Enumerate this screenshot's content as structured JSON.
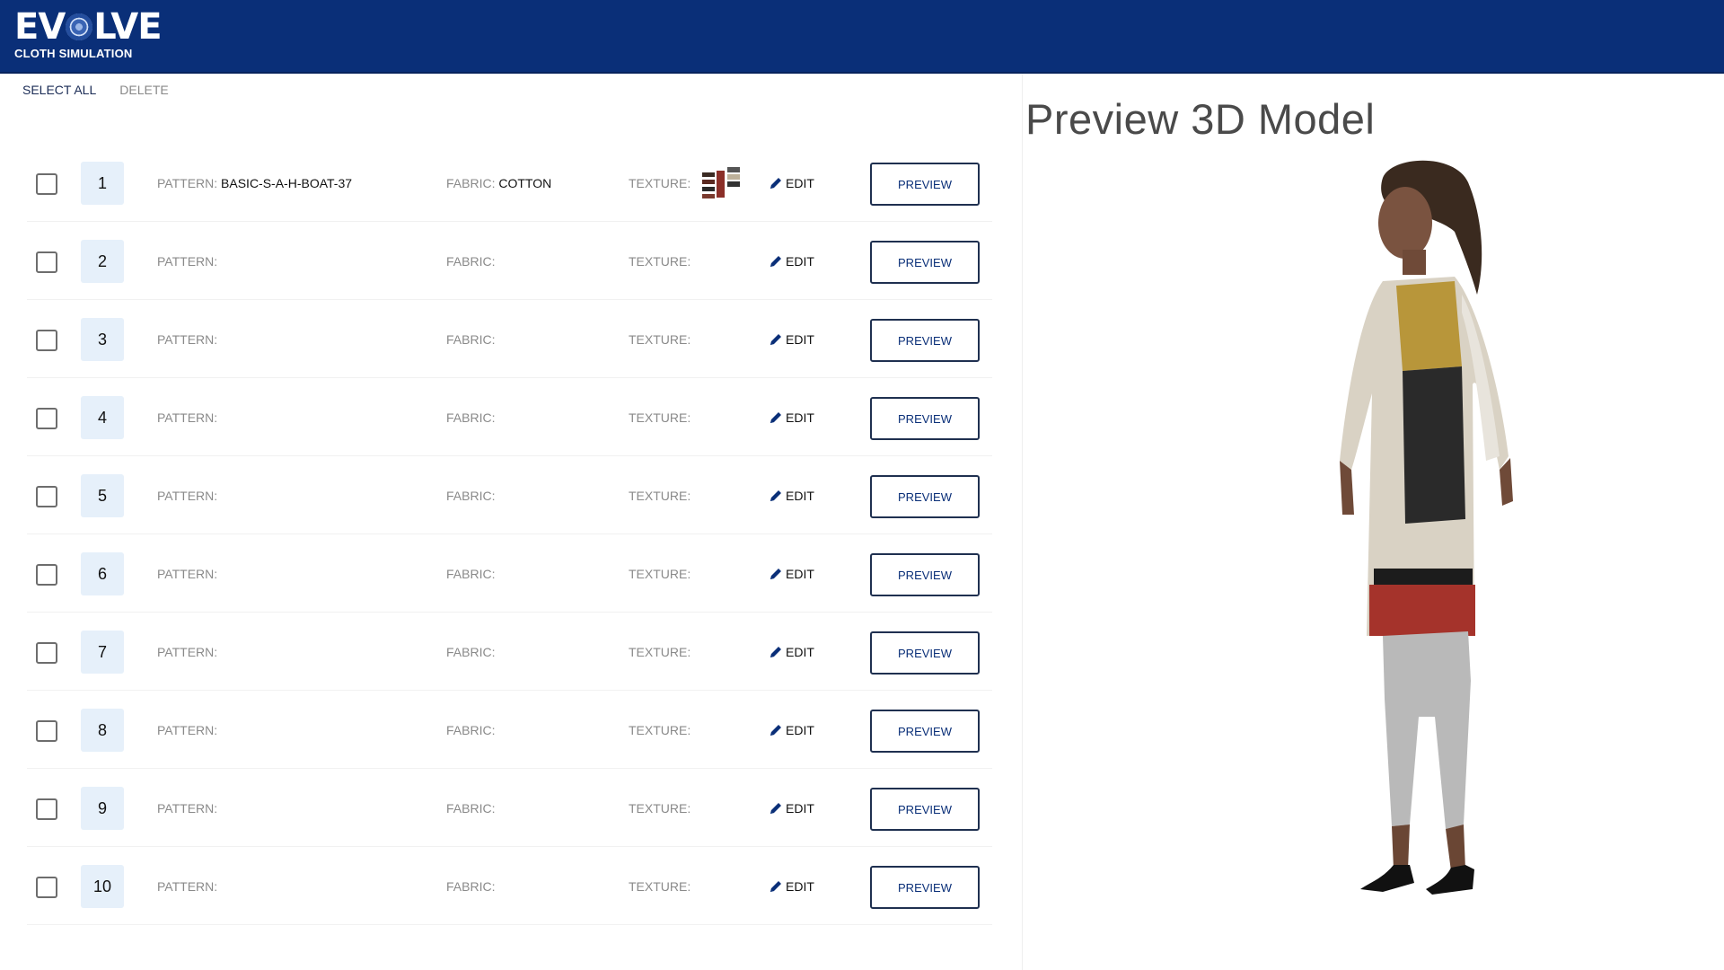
{
  "app": {
    "logo_main_left": "EV",
    "logo_main_right": "LVE",
    "logo_sub": "CLOTH SIMULATION"
  },
  "toolbar": {
    "select_all": "SELECT ALL",
    "delete": "DELETE"
  },
  "labels": {
    "pattern": "PATTERN:",
    "fabric": "FABRIC:",
    "texture": "TEXTURE:",
    "edit": "EDIT",
    "preview": "PREVIEW"
  },
  "rows": [
    {
      "number": "1",
      "pattern": "BASIC-S-A-H-BOAT-37",
      "fabric": "COTTON",
      "has_texture": true,
      "checked": false
    },
    {
      "number": "2",
      "pattern": "",
      "fabric": "",
      "has_texture": false,
      "checked": false
    },
    {
      "number": "3",
      "pattern": "",
      "fabric": "",
      "has_texture": false,
      "checked": false
    },
    {
      "number": "4",
      "pattern": "",
      "fabric": "",
      "has_texture": false,
      "checked": false
    },
    {
      "number": "5",
      "pattern": "",
      "fabric": "",
      "has_texture": false,
      "checked": false
    },
    {
      "number": "6",
      "pattern": "",
      "fabric": "",
      "has_texture": false,
      "checked": false
    },
    {
      "number": "7",
      "pattern": "",
      "fabric": "",
      "has_texture": false,
      "checked": false
    },
    {
      "number": "8",
      "pattern": "",
      "fabric": "",
      "has_texture": false,
      "checked": false
    },
    {
      "number": "9",
      "pattern": "",
      "fabric": "",
      "has_texture": false,
      "checked": false
    },
    {
      "number": "10",
      "pattern": "",
      "fabric": "",
      "has_texture": false,
      "checked": false
    }
  ],
  "preview_panel": {
    "title": "Preview 3D Model"
  },
  "colors": {
    "header_bg": "#0a2f78",
    "number_badge_bg": "#e6f0fa",
    "preview_text": "#0a2f78"
  },
  "icons": {
    "edit": "pencil-icon",
    "texture": "texture-swatch-icon"
  }
}
